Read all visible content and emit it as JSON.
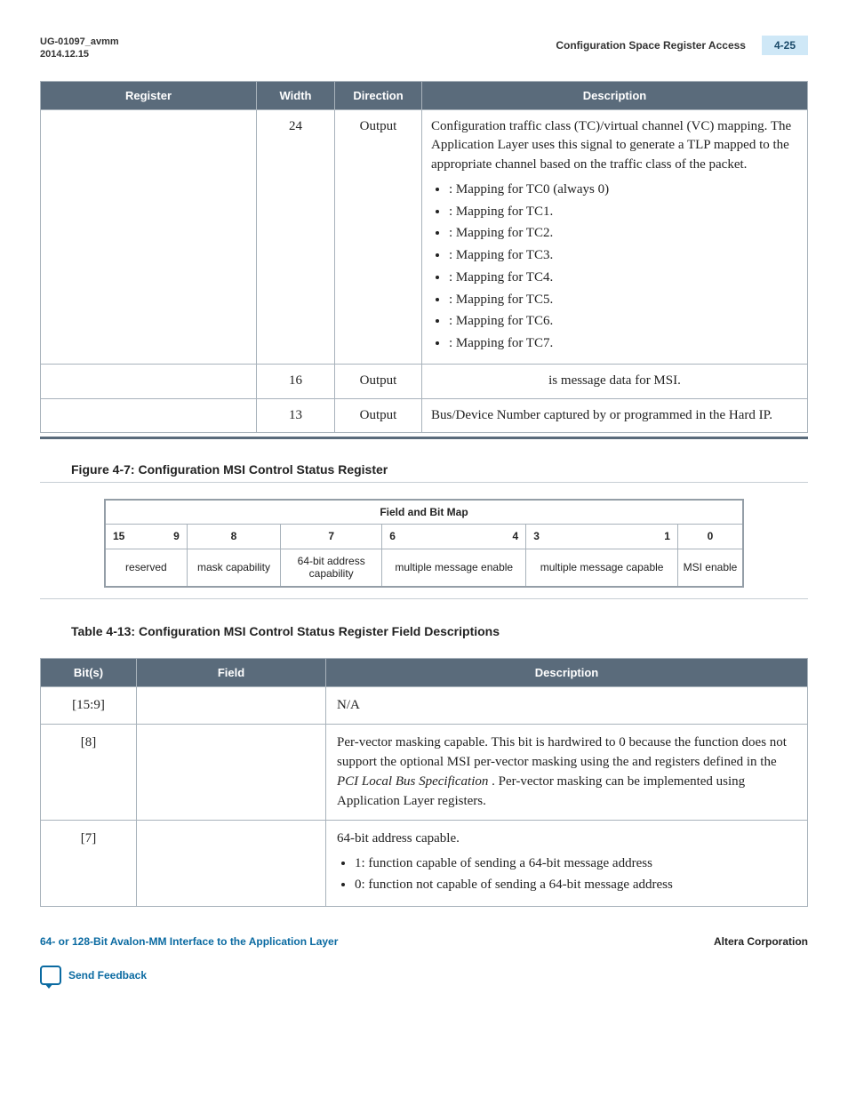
{
  "header": {
    "doc_id": "UG-01097_avmm",
    "date": "2014.12.15",
    "section_title": "Configuration Space Register Access",
    "page_num": "4-25"
  },
  "table1": {
    "headers": {
      "register": "Register",
      "width": "Width",
      "direction": "Direction",
      "description": "Description"
    },
    "rows": [
      {
        "register": "",
        "width": "24",
        "direction": "Output",
        "desc_intro": "Configuration traffic class (TC)/virtual channel (VC) mapping. The Application Layer uses this signal to generate a TLP mapped to the appropriate channel based on the traffic class of the packet.",
        "bullets": [
          ": Mapping for TC0 (always 0)",
          ": Mapping for TC1.",
          ": Mapping for TC2.",
          ": Mapping for TC3.",
          ": Mapping for TC4.",
          ": Mapping for TC5.",
          ": Mapping for TC6.",
          ": Mapping for TC7."
        ]
      },
      {
        "register": "",
        "width": "16",
        "direction": "Output",
        "desc": " is message data for MSI."
      },
      {
        "register": "",
        "width": "13",
        "direction": "Output",
        "desc": "Bus/Device Number captured by or programmed in the Hard IP."
      }
    ]
  },
  "figure47": {
    "caption": "Figure 4-7: Configuration MSI Control Status Register",
    "map_header": "Field and Bit Map",
    "bit_ranges": {
      "r0a": "15",
      "r0b": "9",
      "r1": "8",
      "r2": "7",
      "r3a": "6",
      "r3b": "4",
      "r4a": "3",
      "r4b": "1",
      "r5": "0"
    },
    "fields": {
      "f0": "reserved",
      "f1": "mask capability",
      "f2": "64-bit address capability",
      "f3": "multiple message enable",
      "f4": "multiple message capable",
      "f5": "MSI enable"
    }
  },
  "table413": {
    "caption": "Table 4-13: Configuration MSI Control Status Register Field Descriptions",
    "headers": {
      "bits": "Bit(s)",
      "field": "Field",
      "description": "Description"
    },
    "rows": [
      {
        "bits": "[15:9]",
        "field": "",
        "desc": "N/A"
      },
      {
        "bits": "[8]",
        "field": "",
        "desc_pre": "Per-vector masking capable. This bit is hardwired to 0 because the function does not support the optional MSI per-vector masking using the ",
        "desc_mid1": " and ",
        "desc_mid2": " registers defined in the ",
        "desc_italic": "PCI Local Bus Specification",
        "desc_post": ". Per-vector masking can be implemented using Application Layer registers."
      },
      {
        "bits": "[7]",
        "field": "",
        "desc_head": "64-bit address capable.",
        "bullets": [
          "1: function capable of sending a 64-bit message address",
          "0: function not capable of sending a 64-bit message address"
        ]
      }
    ]
  },
  "footer": {
    "left": "64- or 128-Bit Avalon-MM Interface to the Application Layer",
    "right": "Altera Corporation",
    "feedback": "Send Feedback"
  }
}
